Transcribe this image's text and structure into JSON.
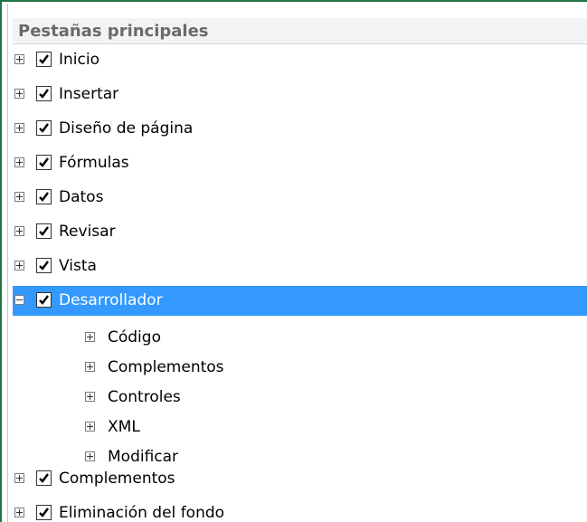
{
  "header": {
    "title": "Pestañas principales"
  },
  "tree": {
    "items": [
      {
        "label": "Inicio",
        "checked": true,
        "expanded": false
      },
      {
        "label": "Insertar",
        "checked": true,
        "expanded": false
      },
      {
        "label": "Diseño de página",
        "checked": true,
        "expanded": false
      },
      {
        "label": "Fórmulas",
        "checked": true,
        "expanded": false
      },
      {
        "label": "Datos",
        "checked": true,
        "expanded": false
      },
      {
        "label": "Revisar",
        "checked": true,
        "expanded": false
      },
      {
        "label": "Vista",
        "checked": true,
        "expanded": false
      },
      {
        "label": "Desarrollador",
        "checked": true,
        "expanded": true,
        "selected": true,
        "children": [
          {
            "label": "Código"
          },
          {
            "label": "Complementos"
          },
          {
            "label": "Controles"
          },
          {
            "label": "XML"
          },
          {
            "label": "Modificar"
          }
        ]
      },
      {
        "label": "Complementos",
        "checked": true,
        "expanded": false
      },
      {
        "label": "Eliminación del fondo",
        "checked": true,
        "expanded": false
      }
    ]
  },
  "colors": {
    "frame_border": "#217346",
    "selection": "#3399ff",
    "header_text": "#6a6a6a"
  }
}
